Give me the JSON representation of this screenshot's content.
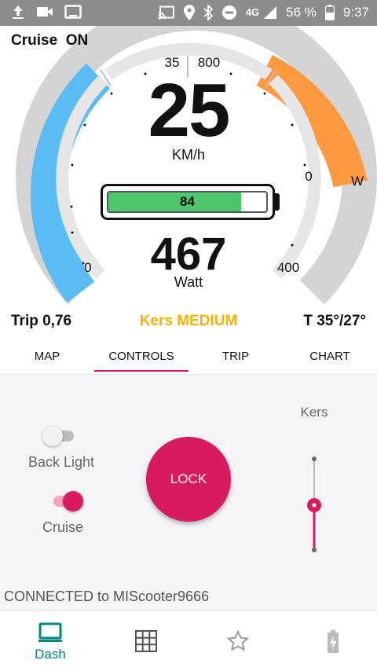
{
  "status_bar": {
    "left_icons": [
      "upload-icon",
      "video-camera-icon",
      "tablet-icon"
    ],
    "right_icons": [
      "cast-icon",
      "location-icon",
      "bluetooth-icon",
      "do-not-disturb-icon",
      "signal-icon"
    ],
    "network": "4G",
    "battery": "56 %",
    "time": "9:37"
  },
  "dashboard": {
    "cruise_status": "Cruise  ON",
    "speed": "25",
    "speed_unit": "KM/h",
    "battery_percent": "84",
    "power": "467",
    "power_unit": "Watt",
    "trip": "Trip 0,76",
    "kers": "Kers MEDIUM",
    "temperature": "T 35°/27°",
    "gauge_labels": {
      "speed_min": "0",
      "speed_mark": "35",
      "power_max": "800",
      "power_zero": "0",
      "power_min": "400",
      "power_unit_side": "W"
    },
    "colors": {
      "speed_arc": "#5bbcf5",
      "power_arc": "#ff9a42",
      "battery_fill": "#4dc56a",
      "kers_text": "#f4b400"
    }
  },
  "tabs": [
    {
      "label": "MAP",
      "active": false
    },
    {
      "label": "CONTROLS",
      "active": true
    },
    {
      "label": "TRIP",
      "active": false
    },
    {
      "label": "CHART",
      "active": false
    }
  ],
  "controls": {
    "back_light": {
      "label": "Back Light",
      "on": false
    },
    "cruise": {
      "label": "Cruise",
      "on": true
    },
    "lock_label": "LOCK",
    "kers_label": "Kers",
    "connected_text": "CONNECTED to MIScooter9666"
  },
  "bottom_nav": [
    {
      "label": "Dash",
      "icon": "dashboard-icon",
      "active": true
    },
    {
      "label": "",
      "icon": "grid-icon",
      "active": false
    },
    {
      "label": "",
      "icon": "star-icon",
      "active": false
    },
    {
      "label": "",
      "icon": "battery-charging-icon",
      "active": false
    }
  ],
  "accent": "#d81b60",
  "nav_accent": "#00897b"
}
